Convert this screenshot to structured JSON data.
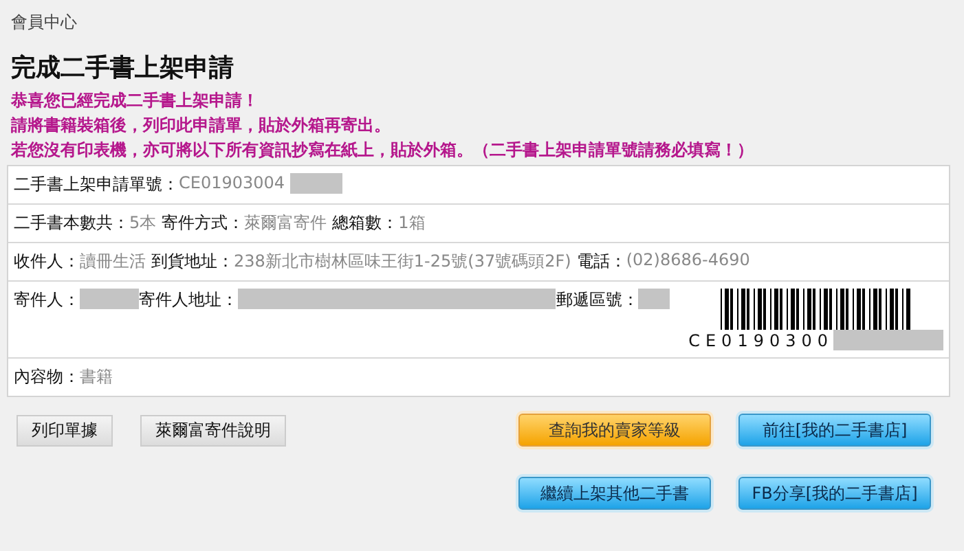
{
  "breadcrumb": "會員中心",
  "title": "完成二手書上架申請",
  "notices": [
    "恭喜您已經完成二手書上架申請！",
    "請將書籍裝箱後，列印此申請單，貼於外箱再寄出。",
    "若您沒有印表機，亦可將以下所有資訊抄寫在紙上，貼於外箱。（二手書上架申請單號請務必填寫！）"
  ],
  "rows": [
    {
      "items": [
        {
          "kind": "label",
          "text": "二手書上架申請單號："
        },
        {
          "kind": "value",
          "text": "CE01903004"
        },
        {
          "kind": "redacted"
        }
      ]
    },
    {
      "items": [
        {
          "kind": "label",
          "text": "二手書本數共："
        },
        {
          "kind": "value",
          "text": "5本"
        },
        {
          "kind": "label",
          "text": "寄件方式："
        },
        {
          "kind": "value",
          "text": "萊爾富寄件"
        },
        {
          "kind": "label",
          "text": "總箱數："
        },
        {
          "kind": "value",
          "text": "1箱"
        }
      ]
    },
    {
      "items": [
        {
          "kind": "label",
          "text": "收件人："
        },
        {
          "kind": "value",
          "text": "讀冊生活"
        },
        {
          "kind": "label",
          "text": "到貨地址："
        },
        {
          "kind": "value",
          "text": "238新北市樹林區味王街1-25號(37號碼頭2F)"
        },
        {
          "kind": "label",
          "text": "電話："
        },
        {
          "kind": "value",
          "text": "(02)8686-4690"
        }
      ]
    },
    {
      "items": [
        {
          "kind": "label",
          "text": "寄件人："
        },
        {
          "kind": "redacted"
        },
        {
          "kind": "label",
          "text": "寄件人地址："
        },
        {
          "kind": "redacted"
        },
        {
          "kind": "label",
          "text": "郵遞區號："
        },
        {
          "kind": "redacted"
        },
        {
          "kind": "barcode",
          "text": "CE0190300"
        }
      ]
    },
    {
      "items": [
        {
          "kind": "label",
          "text": "內容物："
        },
        {
          "kind": "value",
          "text": "書籍"
        }
      ]
    }
  ],
  "buttons": [
    [
      {
        "label": "列印單據",
        "kind": "gray"
      },
      {
        "label": "萊爾富寄件說明",
        "kind": "gray"
      },
      {
        "label": "查詢我的賣家等級",
        "kind": "orange"
      },
      {
        "label": "前往[我的二手書店]",
        "kind": "blue"
      }
    ],
    [
      {
        "label": "繼續上架其他二手書",
        "kind": "blue"
      },
      {
        "label": "FB分享[我的二手書店]",
        "kind": "blue"
      }
    ]
  ]
}
